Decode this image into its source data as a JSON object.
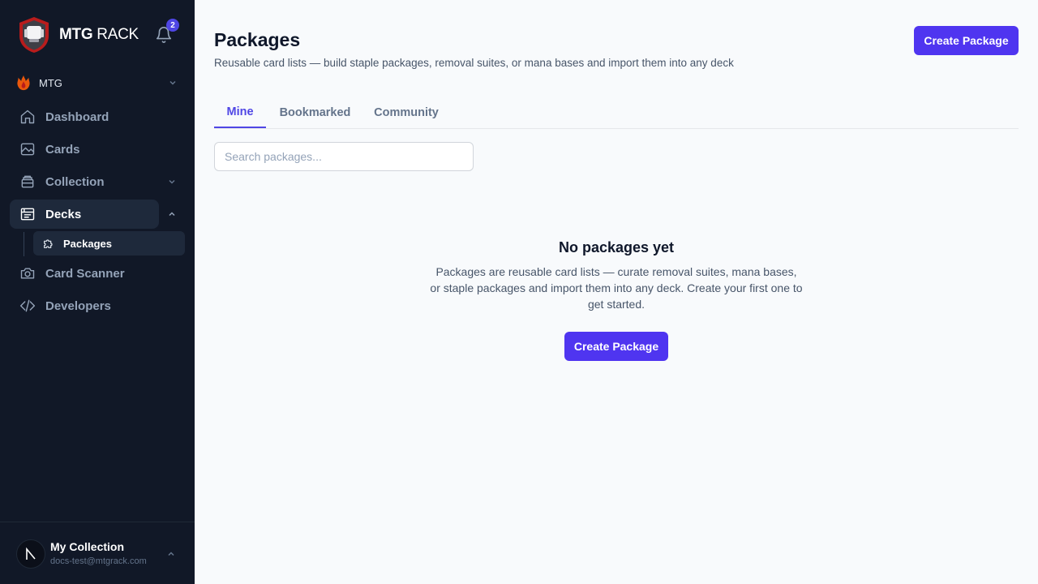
{
  "brand": {
    "name_bold": "MTG",
    "name_light": "RACK"
  },
  "notifications": {
    "count": "2"
  },
  "game": {
    "label": "MTG"
  },
  "nav": [
    {
      "label": "Dashboard",
      "icon": "home-icon"
    },
    {
      "label": "Cards",
      "icon": "image-icon"
    },
    {
      "label": "Collection",
      "icon": "box-icon"
    },
    {
      "label": "Decks",
      "icon": "deck-icon"
    },
    {
      "label": "Card Scanner",
      "icon": "camera-icon"
    },
    {
      "label": "Developers",
      "icon": "code-icon"
    }
  ],
  "subnav": {
    "packages": "Packages"
  },
  "user": {
    "name": "My Collection",
    "email": "docs-test@mtgrack.com"
  },
  "header": {
    "title": "Packages",
    "subtitle": "Reusable card lists — build staple packages, removal suites, or mana bases and import them into any deck",
    "create_label": "Create Package"
  },
  "tabs": [
    {
      "label": "Mine",
      "active": true
    },
    {
      "label": "Bookmarked",
      "active": false
    },
    {
      "label": "Community",
      "active": false
    }
  ],
  "search": {
    "placeholder": "Search packages...",
    "value": ""
  },
  "empty": {
    "title": "No packages yet",
    "description": "Packages are reusable card lists — curate removal suites, mana bases, or staple packages and import them into any deck. Create your first one to get started.",
    "button_label": "Create Package"
  },
  "colors": {
    "sidebar_bg": "#111827",
    "accent": "#4f35f0",
    "page_bg": "#f8fafc"
  }
}
